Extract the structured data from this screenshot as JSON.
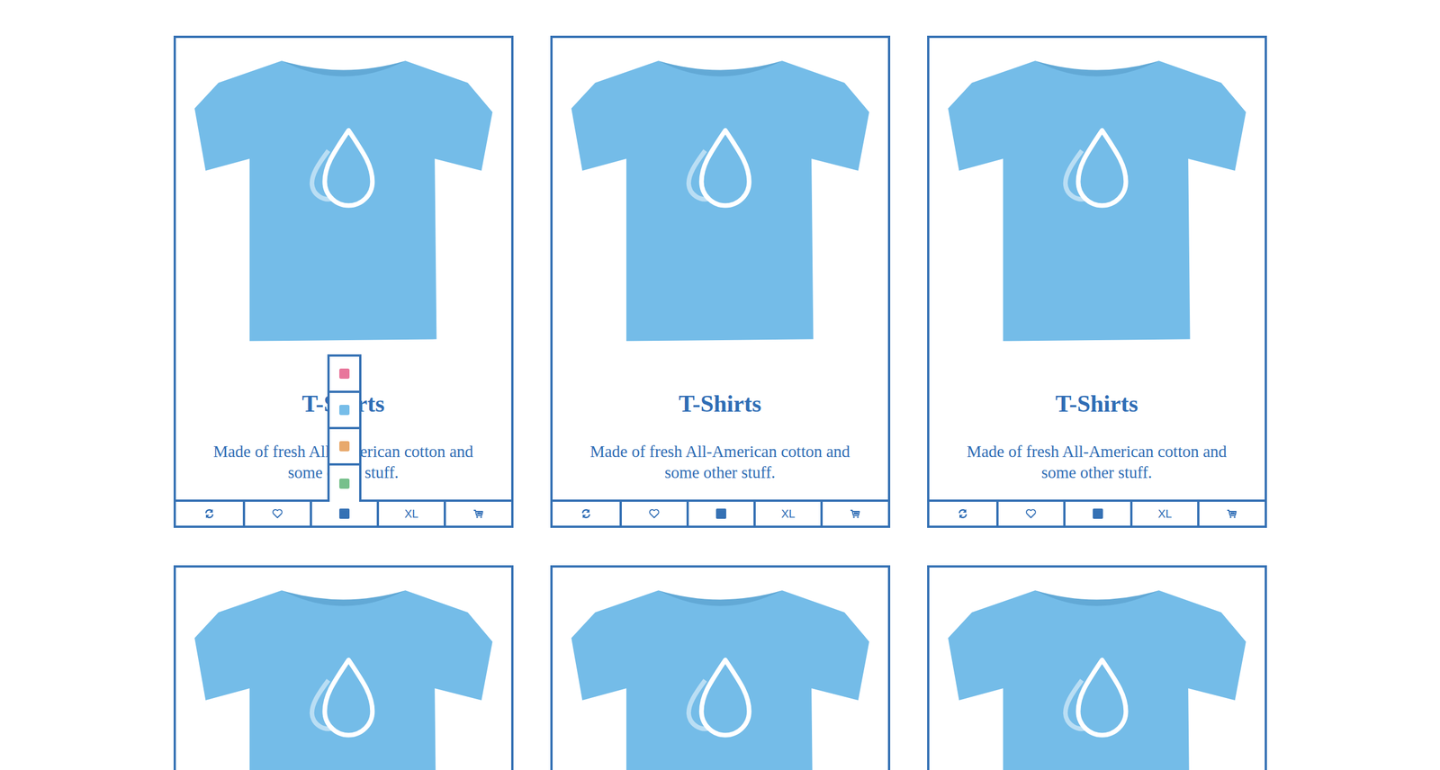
{
  "cards": [
    {
      "kind": "full",
      "title": "T-Shirts",
      "description_lines": [
        "Made of fresh All-American cotton and",
        "some other stuff."
      ],
      "size": "XL",
      "color_menu_open": true,
      "colors": [
        {
          "color": "#e8769b",
          "selected": false
        },
        {
          "color": "#76bde9",
          "selected": false
        },
        {
          "color": "#e8a96c",
          "selected": false
        },
        {
          "color": "#77c08c",
          "selected": false
        }
      ]
    },
    {
      "kind": "full",
      "title": "T-Shirts",
      "description_lines": [
        "Made of fresh All-American cotton and",
        "some other stuff."
      ],
      "size": "XL",
      "color_menu_open": false,
      "colors": []
    },
    {
      "kind": "full",
      "title": "T-Shirts",
      "description_lines": [
        "Made of fresh All-American cotton and",
        "some other stuff."
      ],
      "size": "XL",
      "color_menu_open": false,
      "colors": []
    },
    {
      "kind": "cut"
    },
    {
      "kind": "cut"
    },
    {
      "kind": "cut"
    }
  ]
}
